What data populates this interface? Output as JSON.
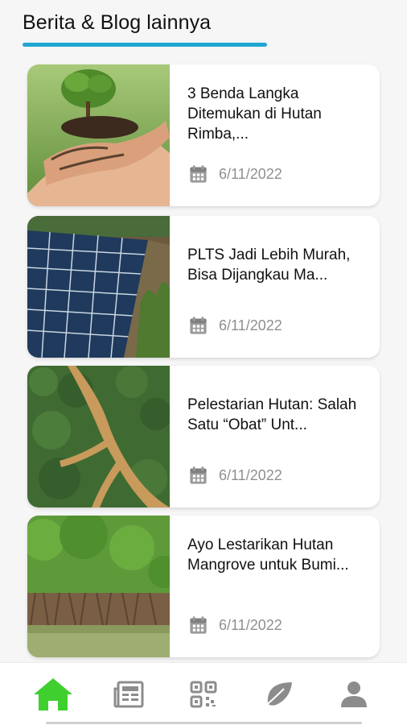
{
  "section": {
    "title": "Berita & Blog lainnya"
  },
  "articles": [
    {
      "title": "3 Benda Langka Ditemukan di Hutan Rimba,...",
      "date": "6/11/2022",
      "image": "hands-holding-seedling"
    },
    {
      "title": "PLTS Jadi Lebih Murah, Bisa Dijangkau Ma...",
      "date": "6/11/2022",
      "image": "solar-panels"
    },
    {
      "title": "Pelestarian Hutan: Salah Satu “Obat” Unt...",
      "date": "6/11/2022",
      "image": "forest-aerial-road"
    },
    {
      "title": "Ayo Lestarikan Hutan Mangrove untuk Bumi...",
      "date": "6/11/2022",
      "image": "mangrove-forest"
    }
  ],
  "bottom_nav": {
    "items": [
      {
        "icon": "home-icon",
        "active": true
      },
      {
        "icon": "newspaper-icon",
        "active": false
      },
      {
        "icon": "qr-code-icon",
        "active": false
      },
      {
        "icon": "leaf-icon",
        "active": false
      },
      {
        "icon": "user-icon",
        "active": false
      }
    ]
  },
  "colors": {
    "accent": "#1fa7d2",
    "active_nav": "#3fcf2f",
    "inactive_nav": "#8c8c8c",
    "date_text": "#8f8f8f"
  }
}
